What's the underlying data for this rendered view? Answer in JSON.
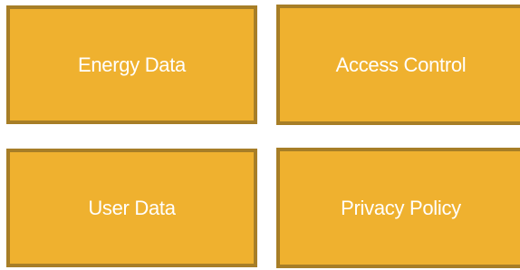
{
  "tiles": [
    {
      "label": "Energy Data"
    },
    {
      "label": "Access Control"
    },
    {
      "label": "User Data"
    },
    {
      "label": "Privacy Policy"
    }
  ],
  "colors": {
    "tile_fill": "#EFB12F",
    "tile_border": "#A77E27",
    "text": "#FFFFFF",
    "background": "#FFFFFF"
  }
}
